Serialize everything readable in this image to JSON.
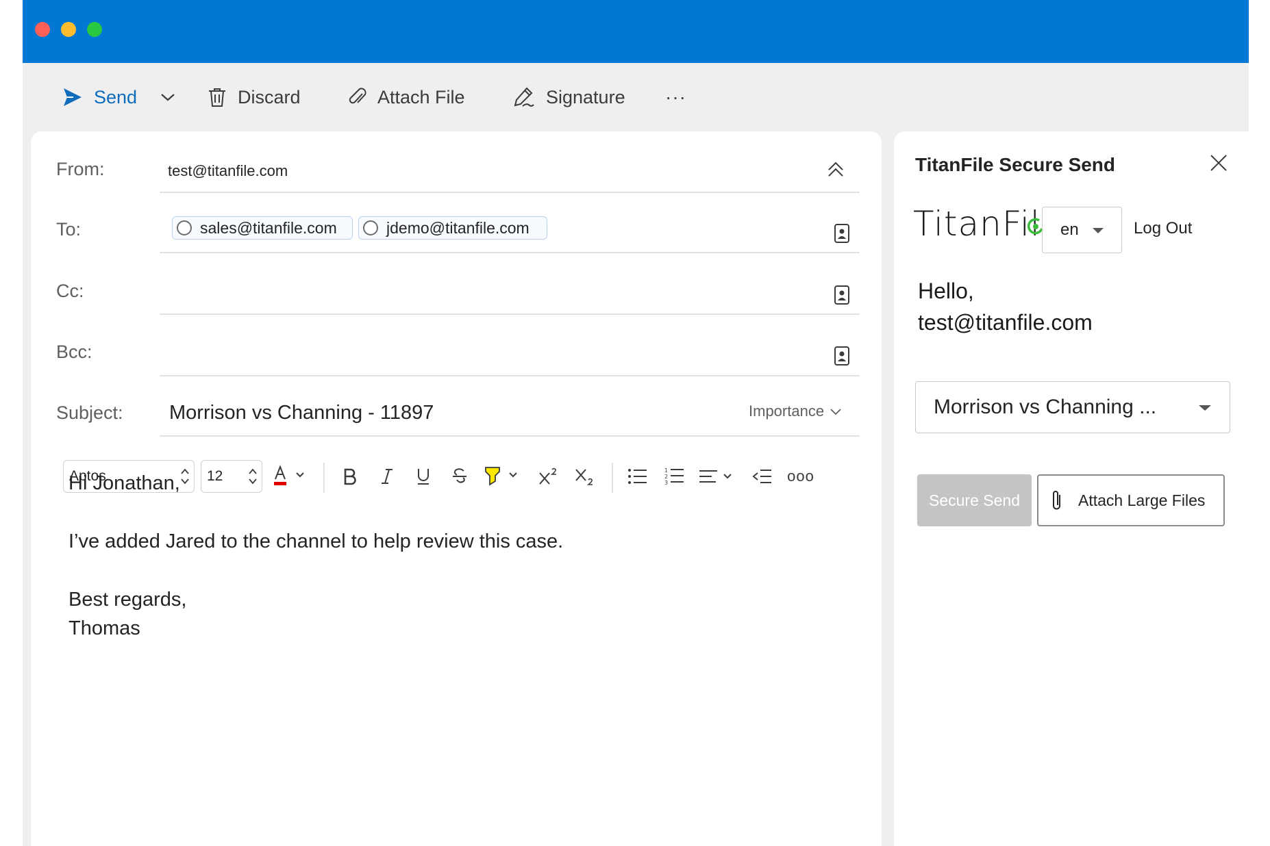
{
  "toolbar": {
    "send_label": "Send",
    "discard_label": "Discard",
    "attach_label": "Attach File",
    "signature_label": "Signature",
    "more_label": "···"
  },
  "compose": {
    "from_label": "From:",
    "from_value": "test@titanfile.com",
    "to_label": "To:",
    "to_recipients": [
      "sales@titanfile.com",
      "jdemo@titanfile.com"
    ],
    "cc_label": "Cc:",
    "bcc_label": "Bcc:",
    "subject_label": "Subject:",
    "subject_value": "Morrison vs Channing - 11897",
    "importance_label": "Importance"
  },
  "format": {
    "font": "Aptos",
    "size": "12",
    "more_label": "ooo"
  },
  "body": {
    "lines": [
      "Hi Jonathan,",
      "I’ve added Jared to the channel to help review this case.",
      "Best regards,",
      "Thomas"
    ]
  },
  "pane": {
    "title": "TitanFile Secure Send",
    "logo_text": "TitanFil",
    "language": "en",
    "logout_label": "Log Out",
    "greeting": "Hello,",
    "user_email": "test@titanfile.com",
    "case_selected": "Morrison vs Channing ...",
    "secure_send_label": "Secure Send",
    "attach_large_label": "Attach Large Files"
  },
  "colors": {
    "titlebar": "#0078d4",
    "send_accent": "#0f6cbd",
    "logo_accent": "#3dbb3d",
    "disabled_button": "#c4c4c4"
  }
}
